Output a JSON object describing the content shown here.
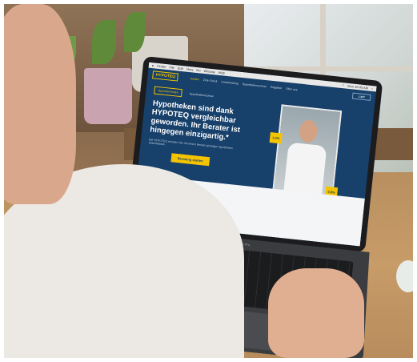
{
  "menubar": {
    "items": [
      "Finder",
      "File",
      "Edit",
      "View",
      "Go",
      "Window",
      "Help"
    ],
    "clock": "Mon 10:45 AM"
  },
  "site": {
    "logo": "HYPOTEQ",
    "nav": [
      "Kaufen",
      "Zins-Check",
      "Umschuldung",
      "Hypothekenrechner",
      "Ratgeber",
      "Über uns"
    ],
    "login": "Login",
    "tabs": [
      "Hypothek finden",
      "Hypothekenrechner"
    ],
    "headline": "Hypotheken sind dank HYPOTEQ vergleichbar geworden. Ihr Berater ist hingegen einzigartig.*",
    "sub": "Bei HYPOTEQ erhalten Sie mit einem Berater günstige Hypotheken abschliessen.",
    "cta": "Beratung starten",
    "badge_top": "1.0%",
    "badge_bottom": "0.9%"
  },
  "laptop": {
    "brand": "MacBook Pro"
  }
}
